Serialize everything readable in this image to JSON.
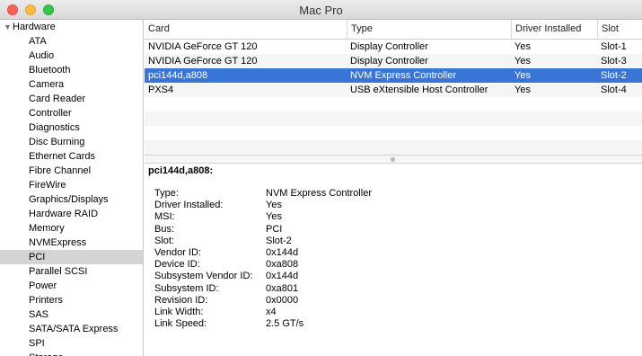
{
  "window": {
    "title": "Mac Pro"
  },
  "sidebar": {
    "section": "Hardware",
    "items": [
      "ATA",
      "Audio",
      "Bluetooth",
      "Camera",
      "Card Reader",
      "Controller",
      "Diagnostics",
      "Disc Burning",
      "Ethernet Cards",
      "Fibre Channel",
      "FireWire",
      "Graphics/Displays",
      "Hardware RAID",
      "Memory",
      "NVMExpress",
      "PCI",
      "Parallel SCSI",
      "Power",
      "Printers",
      "SAS",
      "SATA/SATA Express",
      "SPI",
      "Storage"
    ],
    "selected": "PCI"
  },
  "table": {
    "columns": [
      "Card",
      "Type",
      "Driver Installed",
      "Slot"
    ],
    "rows": [
      [
        "NVIDIA GeForce GT 120",
        "Display Controller",
        "Yes",
        "Slot-1"
      ],
      [
        "NVIDIA GeForce GT 120",
        "Display Controller",
        "Yes",
        "Slot-3"
      ],
      [
        "pci144d,a808",
        "NVM Express Controller",
        "Yes",
        "Slot-2"
      ],
      [
        "PXS4",
        "USB eXtensible Host Controller",
        "Yes",
        "Slot-4"
      ]
    ],
    "selected_row": 2
  },
  "detail": {
    "title": "pci144d,a808:",
    "fields": [
      {
        "k": "Type:",
        "v": "NVM Express Controller"
      },
      {
        "k": "Driver Installed:",
        "v": "Yes"
      },
      {
        "k": "MSI:",
        "v": "Yes"
      },
      {
        "k": "Bus:",
        "v": "PCI"
      },
      {
        "k": "Slot:",
        "v": "Slot-2"
      },
      {
        "k": "Vendor ID:",
        "v": "0x144d"
      },
      {
        "k": "Device ID:",
        "v": "0xa808"
      },
      {
        "k": "Subsystem Vendor ID:",
        "v": "0x144d"
      },
      {
        "k": "Subsystem ID:",
        "v": "0xa801"
      },
      {
        "k": "Revision ID:",
        "v": "0x0000"
      },
      {
        "k": "Link Width:",
        "v": "x4"
      },
      {
        "k": "Link Speed:",
        "v": "2.5 GT/s"
      }
    ]
  }
}
